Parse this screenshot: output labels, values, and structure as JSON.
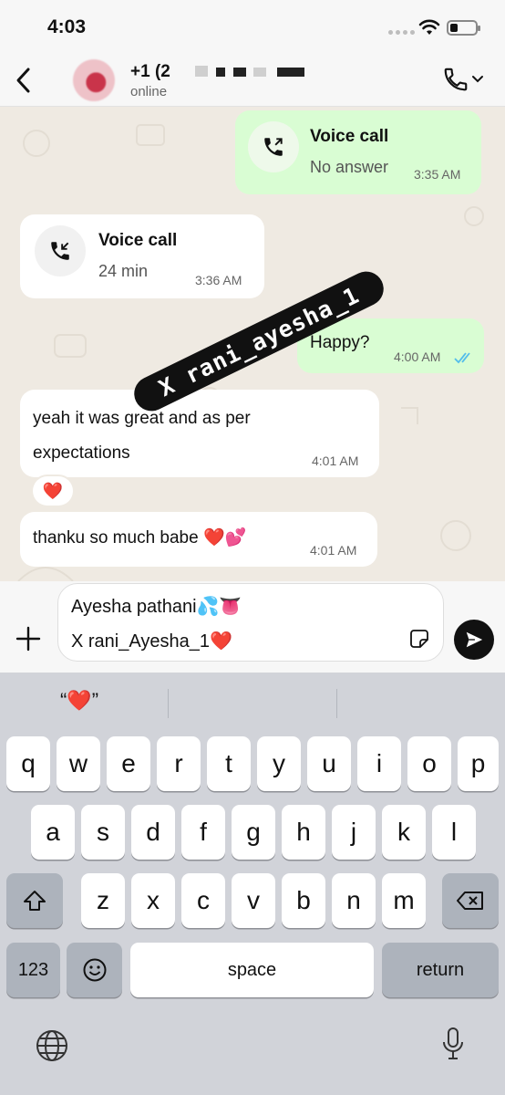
{
  "status_bar": {
    "time": "4:03"
  },
  "header": {
    "contact_name": "+1 (2",
    "contact_status": "online"
  },
  "messages": {
    "call_out": {
      "title": "Voice call",
      "subtitle": "No answer",
      "time": "3:35 AM"
    },
    "call_in": {
      "title": "Voice call",
      "subtitle": "24 min",
      "time": "3:36 AM"
    },
    "happy": {
      "text": "Happy?",
      "time": "4:00 AM"
    },
    "great": {
      "text": "yeah it was great and as per expectations",
      "time": "4:01 AM",
      "reaction": "❤️"
    },
    "thanks": {
      "text": "thanku so much babe ❤️💕",
      "time": "4:01 AM"
    }
  },
  "watermark": "X rani_ayesha_1",
  "composer": {
    "line1": "Ayesha pathani💦👅",
    "line2": "X rani_Ayesha_1❤️"
  },
  "keyboard": {
    "suggestion": "“❤️”",
    "row1": [
      "q",
      "w",
      "e",
      "r",
      "t",
      "y",
      "u",
      "i",
      "o",
      "p"
    ],
    "row2": [
      "a",
      "s",
      "d",
      "f",
      "g",
      "h",
      "j",
      "k",
      "l"
    ],
    "row3": [
      "z",
      "x",
      "c",
      "v",
      "b",
      "n",
      "m"
    ],
    "numbers_key": "123",
    "space_key": "space",
    "return_key": "return"
  },
  "colors": {
    "outgoing_bubble": "#d9fdd3",
    "incoming_bubble": "#ffffff",
    "chat_background": "#efeae2",
    "read_ticks": "#53bdeb"
  }
}
